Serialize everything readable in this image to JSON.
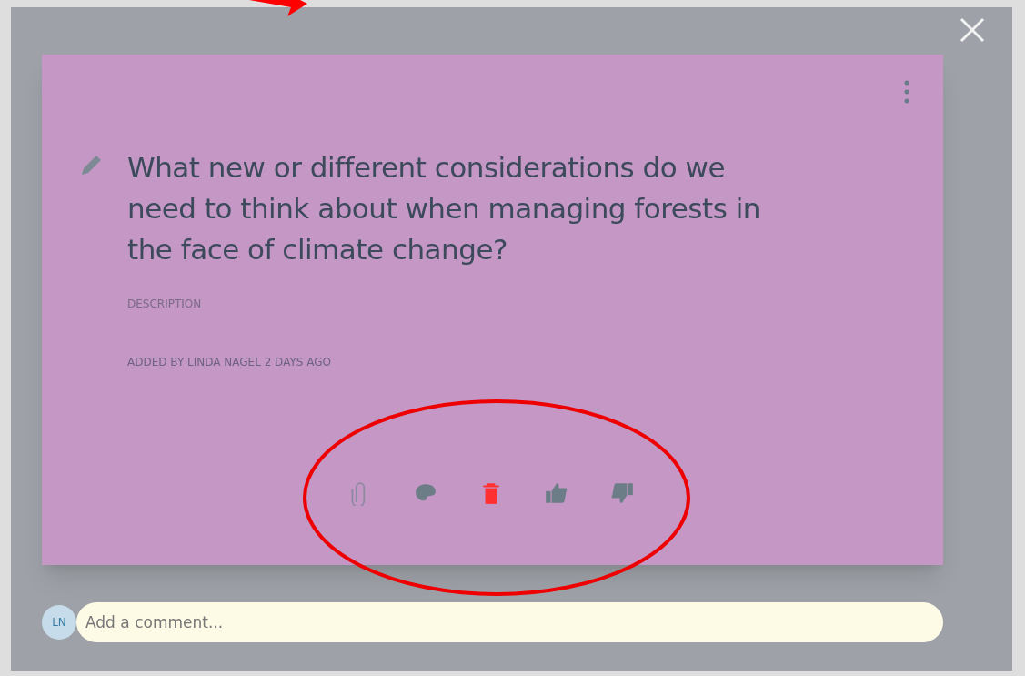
{
  "card": {
    "title": "What new or different considerations do we need to think about when managing forests in the face of climate change?",
    "description_label": "DESCRIPTION",
    "meta": "ADDED BY LINDA NAGEL 2 DAYS AGO",
    "actions": [
      {
        "kind": "attach"
      },
      {
        "kind": "palette"
      },
      {
        "kind": "delete"
      },
      {
        "kind": "like"
      },
      {
        "kind": "dislike"
      }
    ]
  },
  "comment": {
    "avatar": "LN",
    "placeholder": "Add a comment..."
  }
}
